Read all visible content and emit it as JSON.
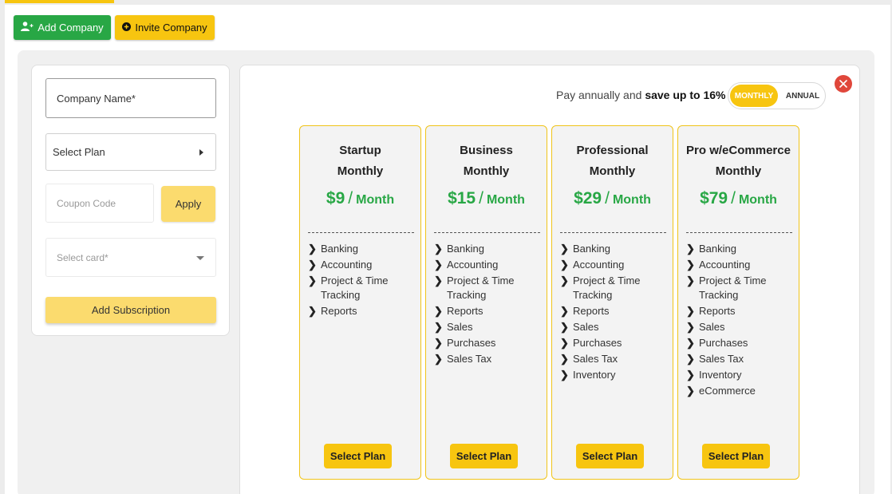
{
  "toolbar": {
    "add_company_label": "Add Company",
    "invite_company_label": "Invite Company"
  },
  "form": {
    "company_name_placeholder": "Company Name*",
    "select_plan_label": "Select Plan",
    "coupon_placeholder": "Coupon Code",
    "apply_label": "Apply",
    "select_card_placeholder": "Select card*",
    "add_subscription_label": "Add Subscription"
  },
  "billing": {
    "pay_text_prefix": "Pay annually and",
    "pay_text_bold": "save up to 16%",
    "toggle_monthly": "MONTHLY",
    "toggle_annual": "ANNUAL",
    "selected": "MONTHLY"
  },
  "plans": [
    {
      "name": "Startup",
      "period": "Monthly",
      "price": "$9",
      "unit": "Month",
      "features": [
        "Banking",
        "Accounting",
        "Project & Time Tracking",
        "Reports"
      ],
      "button": "Select Plan"
    },
    {
      "name": "Business",
      "period": "Monthly",
      "price": "$15",
      "unit": "Month",
      "features": [
        "Banking",
        "Accounting",
        "Project & Time Tracking",
        "Reports",
        "Sales",
        "Purchases",
        "Sales Tax"
      ],
      "button": "Select Plan"
    },
    {
      "name": "Professional",
      "period": "Monthly",
      "price": "$29",
      "unit": "Month",
      "features": [
        "Banking",
        "Accounting",
        "Project & Time Tracking",
        "Reports",
        "Sales",
        "Purchases",
        "Sales Tax",
        "Inventory"
      ],
      "button": "Select Plan"
    },
    {
      "name": "Pro w/eCommerce",
      "period": "Monthly",
      "price": "$79",
      "unit": "Month",
      "features": [
        "Banking",
        "Accounting",
        "Project & Time Tracking",
        "Reports",
        "Sales",
        "Purchases",
        "Sales Tax",
        "Inventory",
        "eCommerce"
      ],
      "button": "Select Plan"
    }
  ],
  "colors": {
    "accent": "#f7c510",
    "green": "#28a745",
    "close": "#e0473b"
  },
  "icons": {
    "add_company": "user-plus-icon",
    "invite_company": "plus-circle-icon",
    "close": "close-icon",
    "feature_bullet": "chevron-right-icon"
  }
}
